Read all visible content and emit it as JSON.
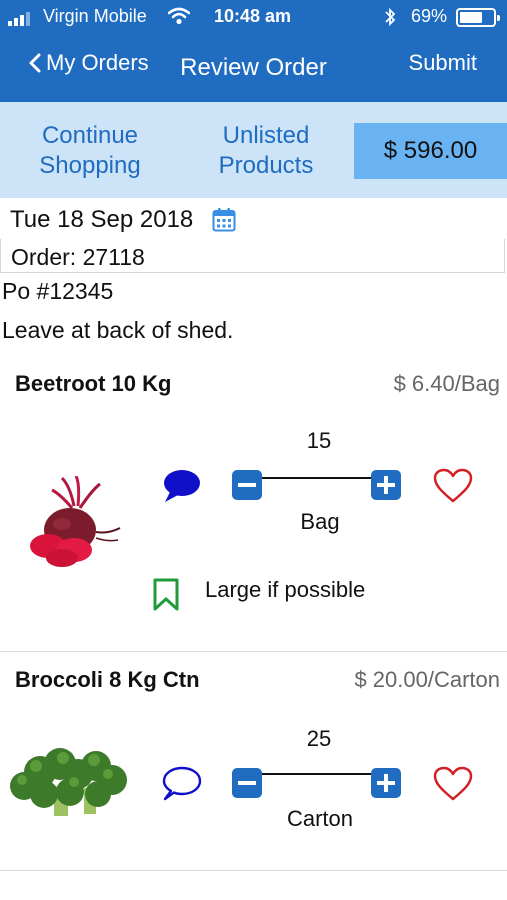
{
  "status_bar": {
    "carrier": "Virgin Mobile",
    "time": "10:48 am",
    "battery": "69%",
    "battery_level": 0.69
  },
  "nav": {
    "back_label": "My Orders",
    "title": "Review Order",
    "submit_label": "Submit"
  },
  "actions": {
    "continue_label": "Continue\nShopping",
    "unlisted_label": "Unlisted\nProducts",
    "total": "$ 596.00"
  },
  "order": {
    "date": "Tue 18 Sep 2018",
    "order_label": "Order: 27118",
    "po": "Po #12345",
    "note": "Leave at back of shed."
  },
  "products": [
    {
      "name": "Beetroot 10 Kg",
      "price": "$ 6.40/Bag",
      "quantity": "15",
      "unit": "Bag",
      "note": "Large if possible",
      "has_comment": true
    },
    {
      "name": "Broccoli 8 Kg Ctn",
      "price": "$ 20.00/Carton",
      "quantity": "25",
      "unit": "Carton",
      "has_comment": false
    }
  ],
  "colors": {
    "brand_blue": "#1f6cc1",
    "action_bar": "#cde4f8",
    "total_bg": "#6ab3f3",
    "heart_red": "#d32027",
    "note_green": "#1f9b3a"
  }
}
